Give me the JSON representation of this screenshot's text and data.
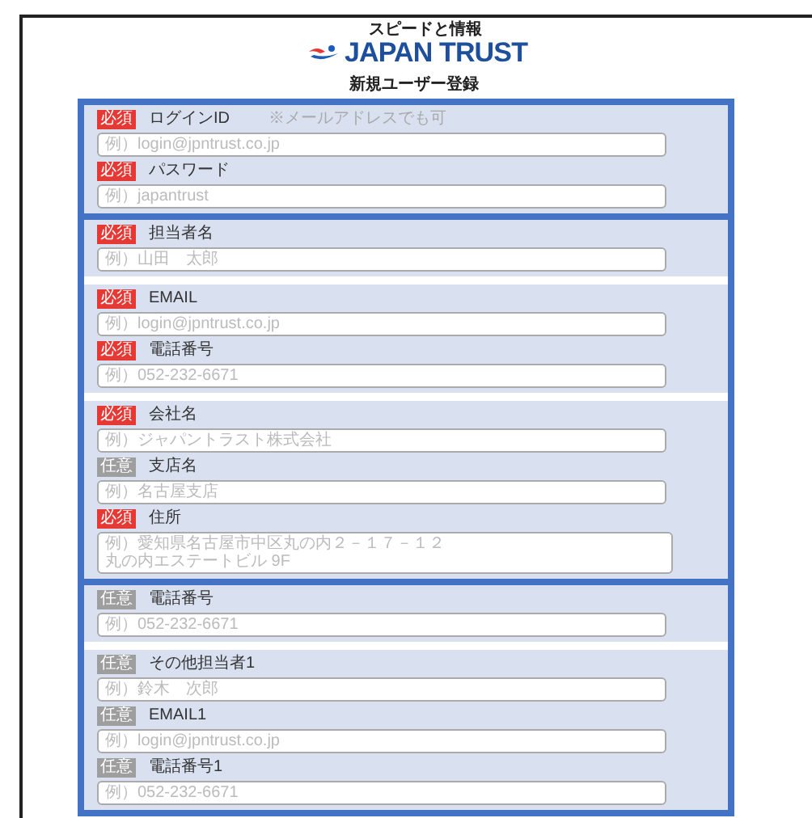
{
  "header": {
    "tagline": "スピードと情報",
    "logo": "JAPAN TRUST",
    "title": "新規ユーザー登録"
  },
  "sections": [
    {
      "panels": [
        {
          "fields": [
            {
              "kind": "input",
              "badge": "必須",
              "required": true,
              "label": "ログインID",
              "note": "※メールアドレスでも可",
              "placeholder": "例）login@jpntrust.co.jp"
            },
            {
              "kind": "input",
              "badge": "必須",
              "required": true,
              "label": "パスワード",
              "placeholder": "例）japantrust"
            }
          ]
        }
      ]
    },
    {
      "panels": [
        {
          "fields": [
            {
              "kind": "input",
              "badge": "必須",
              "required": true,
              "label": "担当者名",
              "placeholder": "例）山田　太郎"
            }
          ]
        },
        {
          "fields": [
            {
              "kind": "input",
              "badge": "必須",
              "required": true,
              "label": "EMAIL",
              "placeholder": "例）login@jpntrust.co.jp"
            },
            {
              "kind": "input",
              "badge": "必須",
              "required": true,
              "label": "電話番号",
              "placeholder": "例）052-232-6671"
            }
          ]
        },
        {
          "fields": [
            {
              "kind": "input",
              "badge": "必須",
              "required": true,
              "label": "会社名",
              "placeholder": "例）ジャパントラスト株式会社"
            },
            {
              "kind": "input",
              "badge": "任意",
              "required": false,
              "label": "支店名",
              "placeholder": "例）名古屋支店"
            },
            {
              "kind": "textarea",
              "badge": "必須",
              "required": true,
              "label": "住所",
              "placeholder": "例）愛知県名古屋市中区丸の内２－１７－１２丸の内エステートビル 9F"
            }
          ]
        }
      ]
    },
    {
      "panels": [
        {
          "fields": [
            {
              "kind": "input",
              "badge": "任意",
              "required": false,
              "label": "電話番号",
              "placeholder": "例）052-232-6671"
            }
          ]
        },
        {
          "fields": [
            {
              "kind": "input",
              "badge": "任意",
              "required": false,
              "label": "その他担当者1",
              "placeholder": "例）鈴木　次郎"
            },
            {
              "kind": "input",
              "badge": "任意",
              "required": false,
              "label": "EMAIL1",
              "placeholder": "例）login@jpntrust.co.jp"
            },
            {
              "kind": "input",
              "badge": "任意",
              "required": false,
              "label": "電話番号1",
              "placeholder": "例）052-232-6671"
            }
          ]
        }
      ]
    }
  ]
}
